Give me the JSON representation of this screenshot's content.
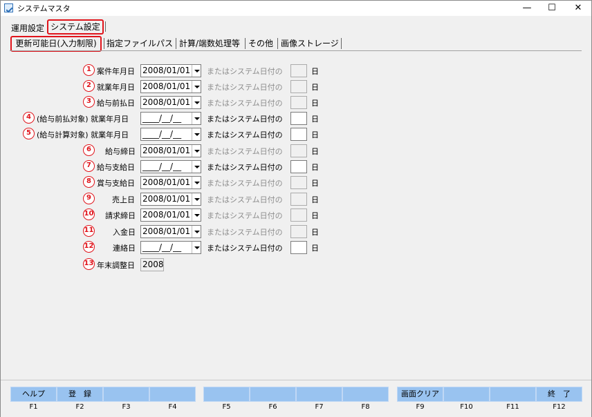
{
  "window": {
    "title": "システムマスタ",
    "minimize": "—",
    "maximize": "☐",
    "close": "✕"
  },
  "tabs": [
    "運用設定",
    "システム設定"
  ],
  "subtabs": [
    "更新可能日(入力制限)",
    "指定ファイルパス",
    "計算/端数処理等",
    "その他",
    "画像ストレージ"
  ],
  "rows": [
    {
      "num": "1",
      "label": "案件年月日",
      "date": "2008/01/01",
      "sys_label": "またはシステム日付の",
      "day": "日"
    },
    {
      "num": "2",
      "label": "就業年月日",
      "date": "2008/01/01",
      "sys_label": "またはシステム日付の",
      "day": "日"
    },
    {
      "num": "3",
      "label": "給与前払日",
      "date": "2008/01/01",
      "sys_label": "またはシステム日付の",
      "day": "日"
    },
    {
      "num": "4",
      "label": "(給与前払対象) 就業年月日",
      "date": "____/__/__",
      "sys_label": "またはシステム日付の",
      "day": "日"
    },
    {
      "num": "5",
      "label": "(給与計算対象) 就業年月日",
      "date": "____/__/__",
      "sys_label": "またはシステム日付の",
      "day": "日"
    },
    {
      "num": "6",
      "label": "給与締日",
      "date": "2008/01/01",
      "sys_label": "またはシステム日付の",
      "day": "日"
    },
    {
      "num": "7",
      "label": "給与支給日",
      "date": "____/__/__",
      "sys_label": "またはシステム日付の",
      "day": "日"
    },
    {
      "num": "8",
      "label": "賞与支給日",
      "date": "2008/01/01",
      "sys_label": "またはシステム日付の",
      "day": "日"
    },
    {
      "num": "9",
      "label": "売上日",
      "date": "2008/01/01",
      "sys_label": "またはシステム日付の",
      "day": "日"
    },
    {
      "num": "10",
      "label": "請求締日",
      "date": "2008/01/01",
      "sys_label": "またはシステム日付の",
      "day": "日"
    },
    {
      "num": "11",
      "label": "入金日",
      "date": "2008/01/01",
      "sys_label": "またはシステム日付の",
      "day": "日"
    },
    {
      "num": "12",
      "label": "連絡日",
      "date": "____/__/__",
      "sys_label": "またはシステム日付の",
      "day": "日"
    }
  ],
  "year_row": {
    "num": "13",
    "label": "年末調整日",
    "value": "2008"
  },
  "fkeys": [
    {
      "label": "ヘルプ",
      "key": "F1"
    },
    {
      "label": "登　録",
      "key": "F2"
    },
    {
      "label": "",
      "key": "F3"
    },
    {
      "label": "",
      "key": "F4"
    },
    {
      "label": "",
      "key": "F5"
    },
    {
      "label": "",
      "key": "F6"
    },
    {
      "label": "",
      "key": "F7"
    },
    {
      "label": "",
      "key": "F8"
    },
    {
      "label": "画面クリア",
      "key": "F9"
    },
    {
      "label": "",
      "key": "F10"
    },
    {
      "label": "",
      "key": "F11"
    },
    {
      "label": "終　了",
      "key": "F12"
    }
  ],
  "colors": {
    "highlight": "#e0141b",
    "fkey": "#99c3f0"
  }
}
